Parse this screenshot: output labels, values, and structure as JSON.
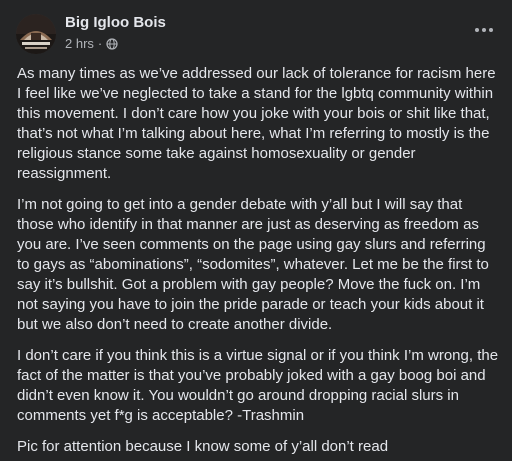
{
  "post": {
    "author": "Big Igloo Bois",
    "time": "2 hrs",
    "separator": "·",
    "privacy_icon": "globe-icon",
    "menu_icon": "more-options-icon",
    "paragraphs": [
      "As many times as we’ve addressed our lack of tolerance for racism here I feel like we’ve neglected to take a stand for the lgbtq community within this movement. I don’t care how you joke with your bois or shit like that, that’s not what I’m talking about here, what I’m referring to mostly is the religious stance some take against homosexuality or gender reassignment.",
      "I’m not going to get into a gender debate with y’all but I will say that those who identify in that manner are just as deserving as freedom as you are. I’ve seen comments on the page using gay slurs and referring to gays as “abominations”, “sodomites”, whatever. Let me be the first to say it’s bullshit. Got a problem with gay people? Move the fuck on. I’m not saying you have to join the pride parade or teach your kids about it but we also don’t need to create another divide.",
      "I don’t care if you think this is a virtue signal or if you think I’m wrong, the fact of the matter is that you’ve probably joked with a gay boog boi and didn’t even know it. You wouldn’t go around dropping racial slurs in comments yet f*g is acceptable? -Trashmin",
      "Pic for attention because I know some of y’all don’t read"
    ]
  },
  "colors": {
    "background": "#242526",
    "primary_text": "#e4e6eb",
    "secondary_text": "#b0b3b8"
  }
}
